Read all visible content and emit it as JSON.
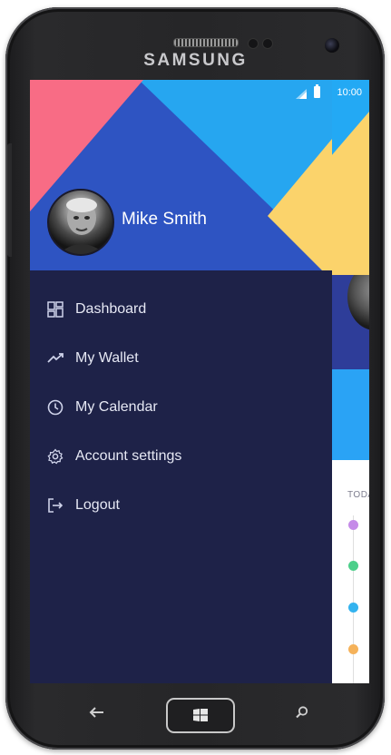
{
  "device": {
    "brand": "SAMSUNG"
  },
  "status_bar": {
    "time": "10:00"
  },
  "profile": {
    "name": "Mike Smith"
  },
  "menu": {
    "items": [
      {
        "label": "Dashboard",
        "icon": "dashboard-icon"
      },
      {
        "label": "My Wallet",
        "icon": "trending-up-icon"
      },
      {
        "label": "My Calendar",
        "icon": "clock-icon"
      },
      {
        "label": "Account settings",
        "icon": "gear-icon"
      },
      {
        "label": "Logout",
        "icon": "logout-icon"
      }
    ]
  },
  "background_app": {
    "section_label": "TODA",
    "timeline_dot_colors": [
      "#c58be8",
      "#4ccf8a",
      "#34b3ef",
      "#f5b25a"
    ]
  },
  "colors": {
    "drawer_bg": "#1e2248",
    "header_blue": "#2e54c2",
    "accent_pink": "#f86c85",
    "accent_cyan": "#23a9f4",
    "accent_yellow": "#fbd36b"
  },
  "nav_bar": {
    "back": "back-icon",
    "home": "windows-home-icon",
    "search": "search-icon"
  }
}
